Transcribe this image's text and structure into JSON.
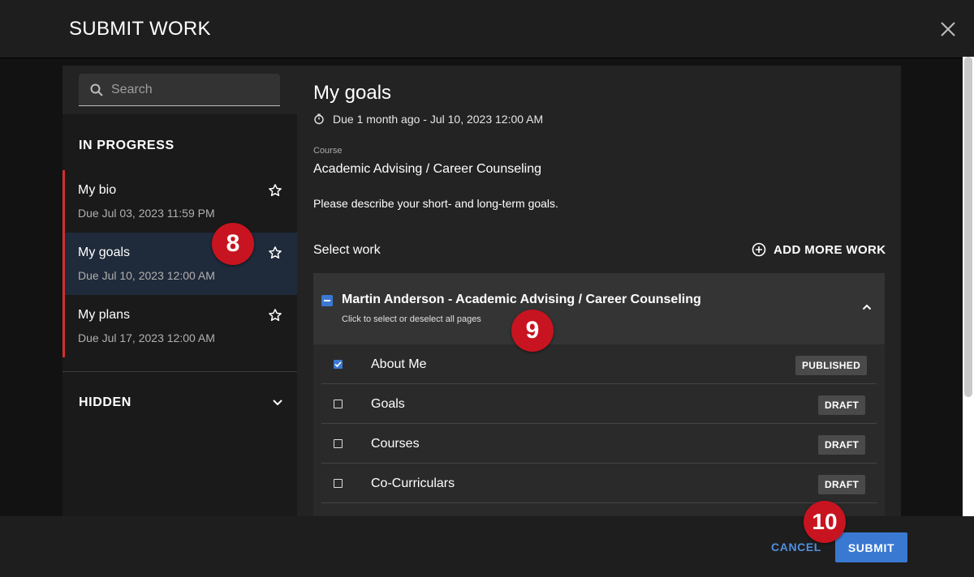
{
  "dialog": {
    "title": "SUBMIT WORK"
  },
  "search": {
    "placeholder": "Search"
  },
  "sidebar": {
    "in_progress_heading": "IN PROGRESS",
    "items": [
      {
        "title": "My bio",
        "due": "Due Jul 03, 2023 11:59 PM"
      },
      {
        "title": "My goals",
        "due": "Due Jul 10, 2023 12:00 AM"
      },
      {
        "title": "My plans",
        "due": "Due Jul 17, 2023 12:00 AM"
      }
    ],
    "hidden_heading": "HIDDEN"
  },
  "main": {
    "title": "My goals",
    "due": "Due 1 month ago - Jul 10, 2023 12:00 AM",
    "course_label": "Course",
    "course_value": "Academic Advising / Career Counseling",
    "prompt": "Please describe your short- and long-term goals.",
    "select_work_label": "Select work",
    "add_more_work": "ADD MORE WORK",
    "portfolio": {
      "title": "Martin Anderson - Academic Advising / Career Counseling",
      "subtitle": "Click to select or deselect all pages"
    },
    "pages": [
      {
        "name": "About Me",
        "status": "PUBLISHED",
        "checked": true
      },
      {
        "name": "Goals",
        "status": "DRAFT",
        "checked": false
      },
      {
        "name": "Courses",
        "status": "DRAFT",
        "checked": false
      },
      {
        "name": "Co-Curriculars",
        "status": "DRAFT",
        "checked": false
      }
    ]
  },
  "footer": {
    "cancel": "CANCEL",
    "submit": "SUBMIT"
  },
  "callouts": [
    "8",
    "9",
    "10"
  ],
  "colors": {
    "accent": "#3a79d2",
    "marker": "#d32f2f",
    "callout": "#c81420"
  }
}
